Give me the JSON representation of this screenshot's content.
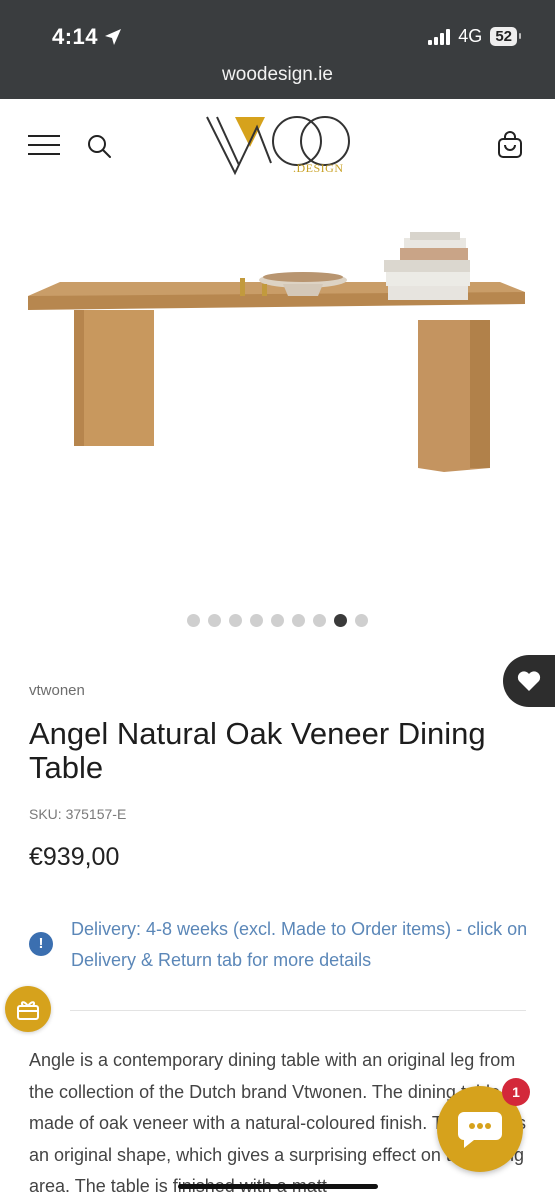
{
  "status_bar": {
    "time": "4:14",
    "network": "4G",
    "battery": "52"
  },
  "browser": {
    "url": "woodesign.ie"
  },
  "header": {
    "logo_text": "WOO",
    "logo_sub": ".DESIGN",
    "icons": [
      "menu-icon",
      "search-icon",
      "cart-icon"
    ]
  },
  "carousel": {
    "total": 9,
    "active_index": 7
  },
  "product": {
    "vendor": "vtwonen",
    "title": "Angel Natural Oak Veneer Dining Table",
    "sku": "SKU: 375157-E",
    "price": "€939,00"
  },
  "delivery": {
    "text": "Delivery: 4-8 weeks (excl. Made to Order items) - click on Delivery & Return tab for more details"
  },
  "description": {
    "text": "Angle is a contemporary dining table with an original leg from the collection of the Dutch brand Vtwonen. The dining table is made of oak veneer with a natural-coloured finish. The leg has an original shape, which gives a surprising effect on the dining area. The table is finished with a matt"
  },
  "chat": {
    "badge_count": "1"
  },
  "colors": {
    "accent": "#d6a21c",
    "link": "#5b87b8",
    "badge": "#d3283a",
    "chrome": "#3a3d3f"
  }
}
